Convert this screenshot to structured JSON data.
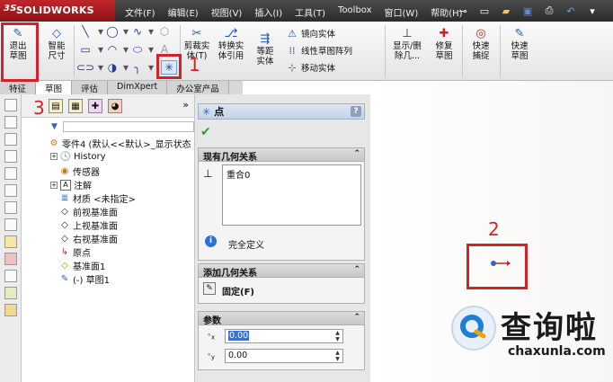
{
  "app": {
    "brand": "SOLIDWORKS",
    "brand_prefix": "3S"
  },
  "menu": {
    "items": [
      "文件(F)",
      "编辑(E)",
      "视图(V)",
      "插入(I)",
      "工具(T)",
      "Toolbox",
      "窗口(W)",
      "帮助(H)"
    ]
  },
  "ribbon": {
    "exit_sketch": "退出草图",
    "smart_dim": "智能尺寸",
    "trim": "剪裁实体(T)",
    "convert": "转换实体引用",
    "offset": "等距实体",
    "mirror": "镜向实体",
    "linear_pattern": "线性草图阵列",
    "move": "移动实体",
    "show_delete": "显示/删除几...",
    "repair": "修复草图",
    "quick_snaps": "快速捕捉",
    "rapid_sketch": "快速草图"
  },
  "tabs": [
    "特征",
    "草图",
    "评估",
    "DimXpert",
    "办公室产品"
  ],
  "tree": {
    "root": "零件4 (默认<<默认>_显示状态",
    "items": [
      "History",
      "传感器",
      "注解",
      "材质 <未指定>",
      "前视基准面",
      "上视基准面",
      "右视基准面",
      "原点",
      "基准面1",
      "(-) 草图1"
    ]
  },
  "pm": {
    "title": "点",
    "help": "?",
    "existing_relations": "现有几何关系",
    "relation_item": "重合0",
    "status": "完全定义",
    "add_relations": "添加几何关系",
    "fix": "固定(F)",
    "params": "参数",
    "x_value": "0.00",
    "y_value": "0.00",
    "x_label": "x",
    "y_label": "y"
  },
  "annotations": {
    "one": "1",
    "two": "2",
    "three": "3"
  },
  "watermark": {
    "logo_text": "查询啦",
    "url": "chaxunla.com"
  },
  "colors": {
    "accent_red": "#d0232a",
    "selection_blue": "#3d6fd1",
    "ok_green": "#2ea02e"
  }
}
